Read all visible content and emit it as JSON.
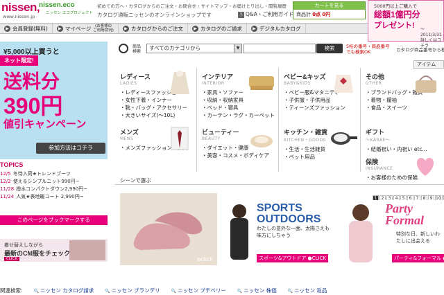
{
  "header": {
    "logo": "nissen,",
    "logo_url": "www.nissen.jp",
    "eco_logo": "nissen.eco",
    "eco_sub": "ニッセン エコプロジェクト",
    "top_links": "初めての方へ・カタログからのご注文・お問合せ・サイトマップ・お届けとり出し・閲覧履歴",
    "tagline": "カタログ通販ニッセンのオンラインショップです",
    "qa_label": "Q&A・ご利用ガイド",
    "cart_button": "カートを見る",
    "cart_items_label": "商品計",
    "cart_items_value": "0点",
    "cart_price_value": "0円"
  },
  "promo": {
    "line1": "5000円以上ご購入で",
    "line2": "総額1億円分",
    "line3": "プレゼント!",
    "detail": "詳しくはコチラ",
    "dates": "〜2011/3/31"
  },
  "nav": {
    "items": [
      {
        "label": "会員登録(無料)"
      },
      {
        "label": "マイページ"
      },
      {
        "label": "カタログからのご注文"
      },
      {
        "label": "カタログのご請求"
      },
      {
        "label": "デジタルカタログ"
      }
    ],
    "mypage_sub": "(お客様の\nご利用状況)"
  },
  "banner": {
    "line1": "¥5,000以上買うと",
    "badge": "ネット限定!",
    "line3": "送料分",
    "line4": "390円",
    "line5": "値引キャンペーン",
    "button": "参加方法はコチラ"
  },
  "topics": {
    "title": "TOPICS",
    "items": [
      {
        "date": "12/5",
        "text": "冬侍入荷★トレンドブーツ"
      },
      {
        "date": "12/2",
        "text": "使えるシンプルニット990円~"
      },
      {
        "date": "11/28",
        "text": "撥水コンパクトダウン2,990円~"
      },
      {
        "date": "11/24",
        "text": "人気★表地暖コート 2,990円~"
      }
    ]
  },
  "bookmark_label": "このページをブックマークする",
  "cm": {
    "line1": "着せ替えしながら",
    "line2": "最新のCM服をチェック",
    "tag": "CLICK"
  },
  "search": {
    "label": "商品\n検索",
    "category_value": "すべてのカテゴリから",
    "button": "検索",
    "note": "5桁の番号・商品番号\nでも検索OK",
    "catalog_link": "カタログ商品番号から検索"
  },
  "item_tab": "アイテム",
  "categories": [
    {
      "title": "レディース",
      "sub": "LADIES",
      "links": [
        "レディースファッション",
        "女性下着・インナー",
        "靴・バッグ・アクセサリー",
        "大きいサイズ(〜10L)"
      ]
    },
    {
      "title": "インテリア",
      "sub": "INTERIOR",
      "links": [
        "家具・ソファー",
        "収納・収納家具",
        "ベッド・寝具",
        "カーテン・ラグ・カーペット"
      ]
    },
    {
      "title": "ベビー&キッズ",
      "sub": "BABY&KIDS",
      "links": [
        "ベビー服&マタニティ",
        "子供服・子供用品",
        "ティーンズファッション"
      ]
    },
    {
      "title": "その他",
      "sub": "OTHER",
      "links": [
        "ブランドバッグ・雑貨",
        "着物・撮袖",
        "食品・スイーツ"
      ]
    },
    {
      "title": "メンズ",
      "sub": "MENS",
      "links": [
        "メンズファッション・雑貨"
      ]
    },
    {
      "title": "ビューティー",
      "sub": "BEAUTY",
      "links": [
        "ダイエット・健康",
        "美容・コスメ・ボディケア"
      ]
    },
    {
      "title": "キッチン・雑貨",
      "sub": "KITCHEN・GOODS",
      "links": [
        "生活・生活雑貨",
        "ペット用品"
      ]
    },
    {
      "title": "ギフト",
      "sub": "〜KARAE〜",
      "links": [
        "結婚祝い・内祝い etc..."
      ],
      "extra_title": "保険",
      "extra_sub": "INSURANCE",
      "extra_links": [
        "お客様のための保険"
      ]
    }
  ],
  "scene": {
    "title": "シーンで選ぶ",
    "shoe_caption": "eclick",
    "sports_title": "SPORTS\nOUTDOORS",
    "sports_text": "わたしの意外な一面、太陽さえも味方にしちゃう",
    "sports_tag": "スポーツ&アウトドア ●CLICK",
    "party_title": "Party\nFormal",
    "party_text": "特別な日、新しいわたしに出会える",
    "party_tag": "パーティ&フォーマル ●CLICK",
    "pages": [
      "1",
      "2",
      "3",
      "4",
      "5",
      "6",
      "7",
      "8",
      "9",
      "10",
      "11",
      "12"
    ]
  },
  "footer": {
    "label": "関連検索:",
    "links": [
      "ニッセン カタログ請求",
      "ニッセン ブランデリ",
      "ニッセン プチベリー",
      "ニッセン 株価",
      "ニッセン 返品"
    ]
  },
  "colors": {
    "brand": "#c8005a",
    "pink": "#e8007a",
    "green": "#7fc04a",
    "link": "#1a3c99"
  }
}
